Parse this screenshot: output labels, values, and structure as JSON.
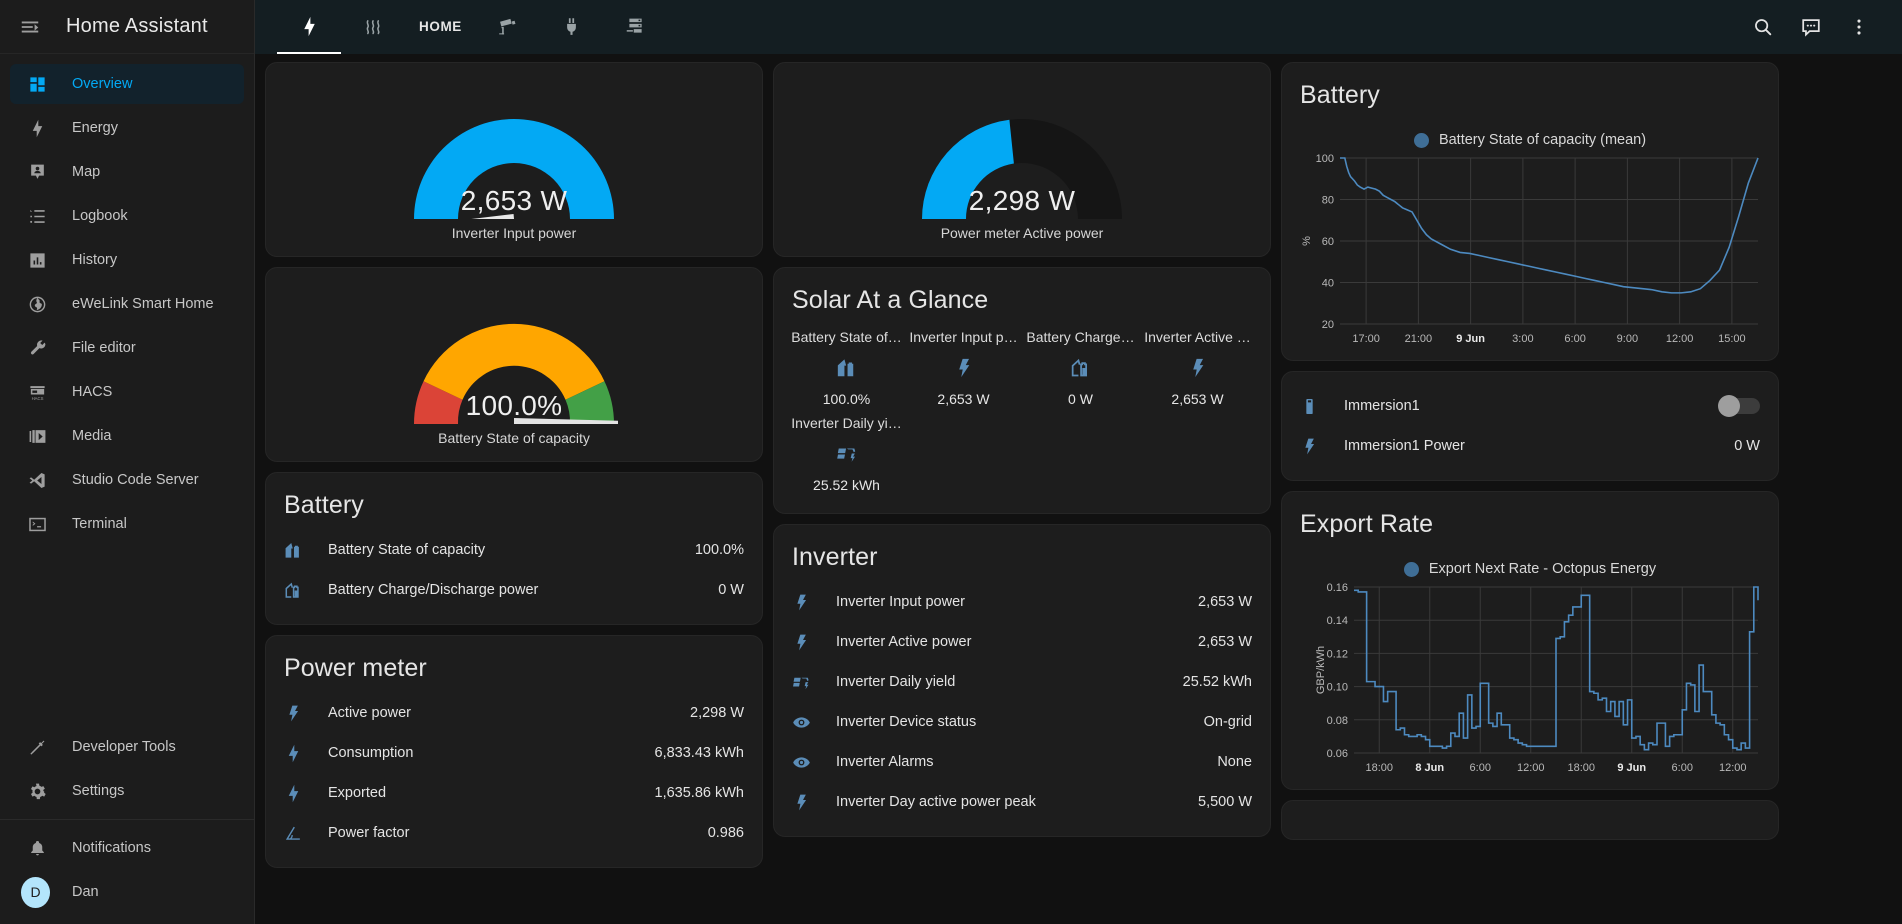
{
  "app": {
    "title": "Home Assistant",
    "menu_icon": "menu-collapse-icon"
  },
  "sidebar": {
    "items": [
      {
        "label": "Overview",
        "icon": "view-dashboard-icon",
        "active": true
      },
      {
        "label": "Energy",
        "icon": "lightning-bolt-icon",
        "active": false
      },
      {
        "label": "Map",
        "icon": "map-marker-account-icon",
        "active": false
      },
      {
        "label": "Logbook",
        "icon": "format-list-bulleted-icon",
        "active": false
      },
      {
        "label": "History",
        "icon": "chart-box-icon",
        "active": false
      },
      {
        "label": "eWeLink Smart Home",
        "icon": "globe-icon",
        "active": false
      },
      {
        "label": "File editor",
        "icon": "wrench-icon",
        "active": false
      },
      {
        "label": "HACS",
        "icon": "hacs-storefront-icon",
        "active": false
      },
      {
        "label": "Media",
        "icon": "play-box-multiple-icon",
        "active": false
      },
      {
        "label": "Studio Code Server",
        "icon": "vscode-icon",
        "active": false
      },
      {
        "label": "Terminal",
        "icon": "console-icon",
        "active": false
      }
    ],
    "tools": [
      {
        "label": "Developer Tools",
        "icon": "hammer-icon"
      },
      {
        "label": "Settings",
        "icon": "gear-icon"
      }
    ],
    "bottom": [
      {
        "label": "Notifications",
        "icon": "bell-icon"
      }
    ],
    "user": {
      "label": "Dan",
      "initial": "D",
      "avatar_color": "#b3e5fc"
    }
  },
  "topbar": {
    "tabs": [
      {
        "id": "energy",
        "icon": "lightning-bolt-icon",
        "label": "",
        "active": true
      },
      {
        "id": "heat",
        "icon": "heat-waves-icon",
        "label": "",
        "active": false
      },
      {
        "id": "home",
        "icon": "",
        "label": "HOME",
        "active": false
      },
      {
        "id": "cameras",
        "icon": "cctv-icon",
        "label": "",
        "active": false
      },
      {
        "id": "plugs",
        "icon": "power-plug-icon",
        "label": "",
        "active": false
      },
      {
        "id": "servers",
        "icon": "server-icon",
        "label": "",
        "active": false
      }
    ],
    "actions": [
      {
        "id": "search",
        "icon": "search-icon"
      },
      {
        "id": "assist",
        "icon": "assist-chat-icon"
      },
      {
        "id": "overflow",
        "icon": "dots-vertical-icon"
      }
    ]
  },
  "cards": {
    "gauge_inverter_input": {
      "value": "2,653 W",
      "name": "Inverter Input power",
      "needle_fraction": 0.47,
      "fill_fraction": 1.0,
      "color": "#03a9f4",
      "track_color": "#03a9f4"
    },
    "gauge_power_meter": {
      "value": "2,298 W",
      "name": "Power meter Active power",
      "needle_fraction": null,
      "fill_fraction": 0.46,
      "color": "#03a9f4",
      "track_color": "#151515"
    },
    "gauge_battery": {
      "value": "100.0%",
      "name": "Battery State of capacity",
      "needle_fraction": 1.0,
      "segments": [
        {
          "from": 0.0,
          "to": 0.2,
          "color": "#db4437"
        },
        {
          "from": 0.2,
          "to": 0.8,
          "color": "#ffa600"
        },
        {
          "from": 0.8,
          "to": 1.0,
          "color": "#43a047"
        }
      ]
    },
    "battery": {
      "title": "Battery",
      "rows": [
        {
          "icon": "home-battery-icon",
          "name": "Battery State of capacity",
          "value": "100.0%"
        },
        {
          "icon": "home-battery-outline-icon",
          "name": "Battery Charge/Discharge power",
          "value": "0 W"
        }
      ]
    },
    "power_meter": {
      "title": "Power meter",
      "rows": [
        {
          "icon": "flash-alert-icon",
          "name": "Active power",
          "value": "2,298 W"
        },
        {
          "icon": "flash-icon",
          "name": "Consumption",
          "value": "6,833.43 kWh"
        },
        {
          "icon": "flash-icon",
          "name": "Exported",
          "value": "1,635.86 kWh"
        },
        {
          "icon": "angle-acute-icon",
          "name": "Power factor",
          "value": "0.986"
        }
      ]
    },
    "solar_glance": {
      "title": "Solar At a Glance",
      "items": [
        {
          "name": "Battery State of…",
          "icon": "home-battery-icon",
          "value": "100.0%"
        },
        {
          "name": "Inverter Input p…",
          "icon": "flash-alert-icon",
          "value": "2,653 W"
        },
        {
          "name": "Battery Charge…",
          "icon": "home-battery-outline-icon",
          "value": "0 W"
        },
        {
          "name": "Inverter Active …",
          "icon": "flash-alert-icon",
          "value": "2,653 W"
        },
        {
          "name": "Inverter Daily yi…",
          "icon": "solar-power-icon",
          "value": "25.52 kWh"
        }
      ]
    },
    "inverter": {
      "title": "Inverter",
      "rows": [
        {
          "icon": "flash-alert-icon",
          "name": "Inverter Input power",
          "value": "2,653 W"
        },
        {
          "icon": "flash-alert-icon",
          "name": "Inverter Active power",
          "value": "2,653 W"
        },
        {
          "icon": "solar-power-icon",
          "name": "Inverter Daily yield",
          "value": "25.52 kWh"
        },
        {
          "icon": "eye-icon",
          "name": "Inverter Device status",
          "value": "On-grid"
        },
        {
          "icon": "eye-icon",
          "name": "Inverter Alarms",
          "value": "None"
        },
        {
          "icon": "flash-alert-icon",
          "name": "Inverter Day active power peak",
          "value": "5,500 W"
        }
      ]
    },
    "battery_chart": {
      "title": "Battery"
    },
    "immersion": {
      "rows": [
        {
          "icon": "water-boiler-icon",
          "name": "Immersion1",
          "control": "toggle",
          "toggle_on": false
        },
        {
          "icon": "flash-alert-icon",
          "name": "Immersion1 Power",
          "value": "0 W"
        }
      ]
    },
    "export_rate_chart": {
      "title": "Export Rate"
    }
  },
  "chart_data": [
    {
      "id": "battery_history",
      "type": "line",
      "title": "Battery",
      "legend": [
        "Battery State of capacity (mean)"
      ],
      "legend_position": "top-center",
      "legend_color": "#3f6e96",
      "line_color": "#4d8ac0",
      "xlabel": "",
      "ylabel": "%",
      "ylim": [
        20,
        100
      ],
      "yticks": [
        20,
        40,
        60,
        80,
        100
      ],
      "xticks": [
        "17:00",
        "21:00",
        "9 Jun",
        "3:00",
        "6:00",
        "9:00",
        "12:00",
        "15:00"
      ],
      "xtick_bold": [
        "9 Jun"
      ],
      "grid": true,
      "x": [
        16.5,
        17.0,
        17.2,
        17.4,
        17.6,
        17.8,
        18.0,
        18.3,
        18.6,
        19.0,
        19.4,
        19.8,
        20.2,
        20.6,
        21.0,
        21.4,
        21.8,
        22.2,
        22.6,
        23.0,
        23.5,
        24.0,
        24.5,
        25.0,
        25.5,
        26.0,
        27.0,
        28.0,
        29.0,
        30.0,
        31.0,
        32.0,
        33.0,
        34.0,
        35.0,
        36.0,
        37.0,
        38.0,
        39.0,
        40.0,
        41.0,
        42.0,
        43.0,
        44.0,
        45.0,
        46.0,
        47.0,
        48.0,
        49.0,
        50.0,
        51.0,
        52.0,
        53.0,
        54.0,
        55.0,
        56.0,
        57.0,
        58.0,
        59.0,
        60.0
      ],
      "y": [
        100,
        100,
        96,
        93,
        91,
        90,
        89,
        87,
        86,
        85,
        86,
        85.5,
        85,
        84,
        82,
        81,
        80,
        79,
        77.5,
        76,
        75,
        74,
        70,
        66,
        63,
        61,
        58.5,
        56,
        54.5,
        54,
        53,
        52,
        51,
        50,
        49,
        48,
        47,
        46,
        45,
        44,
        43,
        42,
        41,
        40,
        39,
        38,
        37.5,
        37,
        36.5,
        35.5,
        35,
        35,
        35.5,
        37,
        41,
        46,
        57,
        72,
        88,
        100
      ],
      "notes": "Battery state of capacity falls from 100% at 17:00 to a minimum near 35% around 07:30, then recharges to 100% by ~12:30 and stays flat."
    },
    {
      "id": "export_rate",
      "type": "line",
      "title": "Export Rate",
      "legend": [
        "Export Next Rate - Octopus Energy"
      ],
      "legend_position": "top-center",
      "legend_color": "#3f6e96",
      "line_color": "#4d8ac0",
      "xlabel": "",
      "ylabel": "GBP/kWh",
      "ylim": [
        0.06,
        0.16
      ],
      "yticks": [
        0.06,
        0.08,
        0.1,
        0.12,
        0.14,
        0.16
      ],
      "xticks": [
        "18:00",
        "8 Jun",
        "6:00",
        "12:00",
        "18:00",
        "9 Jun",
        "6:00",
        "12:00"
      ],
      "xtick_bold": [
        "8 Jun",
        "9 Jun"
      ],
      "grid": true,
      "step": true,
      "x": [
        0,
        1,
        2,
        3,
        4,
        5,
        6,
        7,
        8,
        9,
        10,
        11,
        12,
        13,
        14,
        15,
        16,
        17,
        18,
        19,
        20,
        21,
        22,
        23,
        24,
        25,
        26,
        27,
        28,
        29,
        30,
        31,
        32,
        33,
        34,
        35,
        36,
        37,
        38,
        39,
        40,
        41,
        42,
        43,
        44,
        45,
        46,
        47,
        48,
        49,
        50,
        51,
        52,
        53,
        54,
        55,
        56,
        57,
        58,
        59,
        60,
        61,
        62,
        63,
        64,
        65,
        66,
        67,
        68,
        69,
        70,
        71,
        72,
        73,
        74,
        75,
        76,
        77,
        78,
        79,
        80,
        81,
        82,
        83,
        84,
        85,
        86,
        87,
        88,
        89,
        90,
        91,
        92,
        93,
        94,
        95,
        96
      ],
      "y": [
        0.158,
        0.157,
        0.157,
        0.103,
        0.103,
        0.1,
        0.1,
        0.091,
        0.097,
        0.097,
        0.074,
        0.075,
        0.071,
        0.07,
        0.07,
        0.071,
        0.07,
        0.068,
        0.064,
        0.064,
        0.064,
        0.063,
        0.064,
        0.072,
        0.07,
        0.084,
        0.069,
        0.095,
        0.075,
        0.076,
        0.102,
        0.102,
        0.078,
        0.076,
        0.084,
        0.077,
        0.077,
        0.069,
        0.068,
        0.066,
        0.065,
        0.064,
        0.064,
        0.064,
        0.064,
        0.064,
        0.064,
        0.064,
        0.129,
        0.13,
        0.139,
        0.143,
        0.148,
        0.148,
        0.155,
        0.155,
        0.097,
        0.096,
        0.092,
        0.093,
        0.085,
        0.091,
        0.082,
        0.091,
        0.077,
        0.092,
        0.069,
        0.07,
        0.065,
        0.062,
        0.066,
        0.065,
        0.078,
        0.078,
        0.064,
        0.07,
        0.071,
        0.071,
        0.086,
        0.102,
        0.101,
        0.085,
        0.113,
        0.097,
        0.097,
        0.083,
        0.078,
        0.077,
        0.071,
        0.068,
        0.063,
        0.062,
        0.066,
        0.063,
        0.133,
        0.16,
        0.152
      ],
      "notes": "Half-hourly Octopus export rate stepping between ~0.06 and ~0.16 GBP/kWh with evening peaks near 18:00 on both days."
    }
  ]
}
